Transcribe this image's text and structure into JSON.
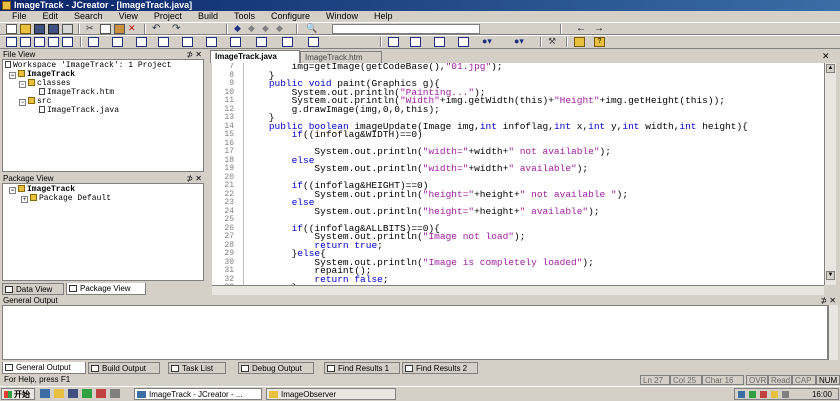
{
  "window": {
    "title": "ImageTrack - JCreator - [ImageTrack.java]"
  },
  "menu": [
    "File",
    "Edit",
    "Search",
    "View",
    "Project",
    "Build",
    "Tools",
    "Configure",
    "Window",
    "Help"
  ],
  "file_view": {
    "title": "File View",
    "items": [
      {
        "label": "Workspace 'ImageTrack': 1 Project",
        "indent": 0,
        "icon": "workspace-icon"
      },
      {
        "label": "ImageTrack",
        "indent": 1,
        "icon": "project-icon",
        "bold": true
      },
      {
        "label": "classes",
        "indent": 2,
        "icon": "folder-icon"
      },
      {
        "label": "ImageTrack.htm",
        "indent": 3,
        "icon": "file-icon"
      },
      {
        "label": "src",
        "indent": 2,
        "icon": "folder-icon"
      },
      {
        "label": "ImageTrack.java",
        "indent": 3,
        "icon": "java-file-icon"
      }
    ]
  },
  "package_view": {
    "title": "Package View",
    "items": [
      {
        "label": "ImageTrack",
        "indent": 0,
        "icon": "project-icon",
        "bold": true
      },
      {
        "label": "Package Default",
        "indent": 1,
        "icon": "package-icon"
      }
    ]
  },
  "left_tabs": [
    "Data View",
    "Package View"
  ],
  "editor_tabs": [
    "ImageTrack.java",
    "ImageTrack.htm"
  ],
  "code": {
    "lines": [
      {
        "n": "7",
        "text": "        img=getImage(getCodeBase(),\"01.jpg\");"
      },
      {
        "n": "8",
        "text": "    }"
      },
      {
        "n": "9",
        "text": "    public void paint(Graphics g){"
      },
      {
        "n": "10",
        "text": "        System.out.println(\"Painting...\");"
      },
      {
        "n": "11",
        "text": "        System.out.println(\"Width\"+img.getWidth(this)+\"Height\"+img.getHeight(this));"
      },
      {
        "n": "12",
        "text": "        g.drawImage(img,0,0,this);"
      },
      {
        "n": "13",
        "text": "    }"
      },
      {
        "n": "14",
        "text": "    public boolean imageUpdate(Image img,int infoflag,int x,int y,int width,int height){"
      },
      {
        "n": "15",
        "text": "        if((infoflag&WIDTH)==0)"
      },
      {
        "n": "16",
        "text": ""
      },
      {
        "n": "17",
        "text": "            System.out.println(\"width=\"+width+\" not available\");"
      },
      {
        "n": "18",
        "text": "        else"
      },
      {
        "n": "19",
        "text": "            System.out.println(\"width=\"+width+\" available\");"
      },
      {
        "n": "20",
        "text": ""
      },
      {
        "n": "21",
        "text": "        if((infoflag&HEIGHT)==0)"
      },
      {
        "n": "22",
        "text": "            System.out.println(\"height=\"+height+\" not available \");"
      },
      {
        "n": "23",
        "text": "        else"
      },
      {
        "n": "24",
        "text": "            System.out.println(\"height=\"+height+\" available\");"
      },
      {
        "n": "25",
        "text": ""
      },
      {
        "n": "26",
        "text": "        if((infoflag&ALLBITS)==0){"
      },
      {
        "n": "27",
        "text": "            System.out.println(\"Image not load\");"
      },
      {
        "n": "28",
        "text": "            return true;"
      },
      {
        "n": "29",
        "text": "        }else{"
      },
      {
        "n": "30",
        "text": "            System.out.println(\"Image is completely loaded\");"
      },
      {
        "n": "31",
        "text": "            repaint();"
      },
      {
        "n": "32",
        "text": "            return false;"
      },
      {
        "n": "33",
        "text": "        }"
      },
      {
        "n": "34",
        "text": "    }"
      },
      {
        "n": "35",
        "text": ""
      },
      {
        "n": "36",
        "text": "}"
      }
    ]
  },
  "general_output": {
    "title": "General Output"
  },
  "bottom_tabs": [
    "General Output",
    "Build Output",
    "Task List",
    "Debug Output",
    "Find Results 1",
    "Find Results 2"
  ],
  "status": {
    "help": "For Help, press F1",
    "ln": "Ln 27",
    "col": "Col 25",
    "char": "Char 16",
    "ovr": "OVR",
    "read": "Read",
    "cap": "CAP",
    "num": "NUM"
  },
  "taskbar": {
    "start": "开始",
    "tasks": [
      "ImageTrack - JCreator - ...",
      "ImageObserver"
    ],
    "clock": "16:00"
  },
  "colors": {
    "keyword": "#0000cc",
    "string": "#a020a0",
    "titlebar": "#0a246a"
  }
}
